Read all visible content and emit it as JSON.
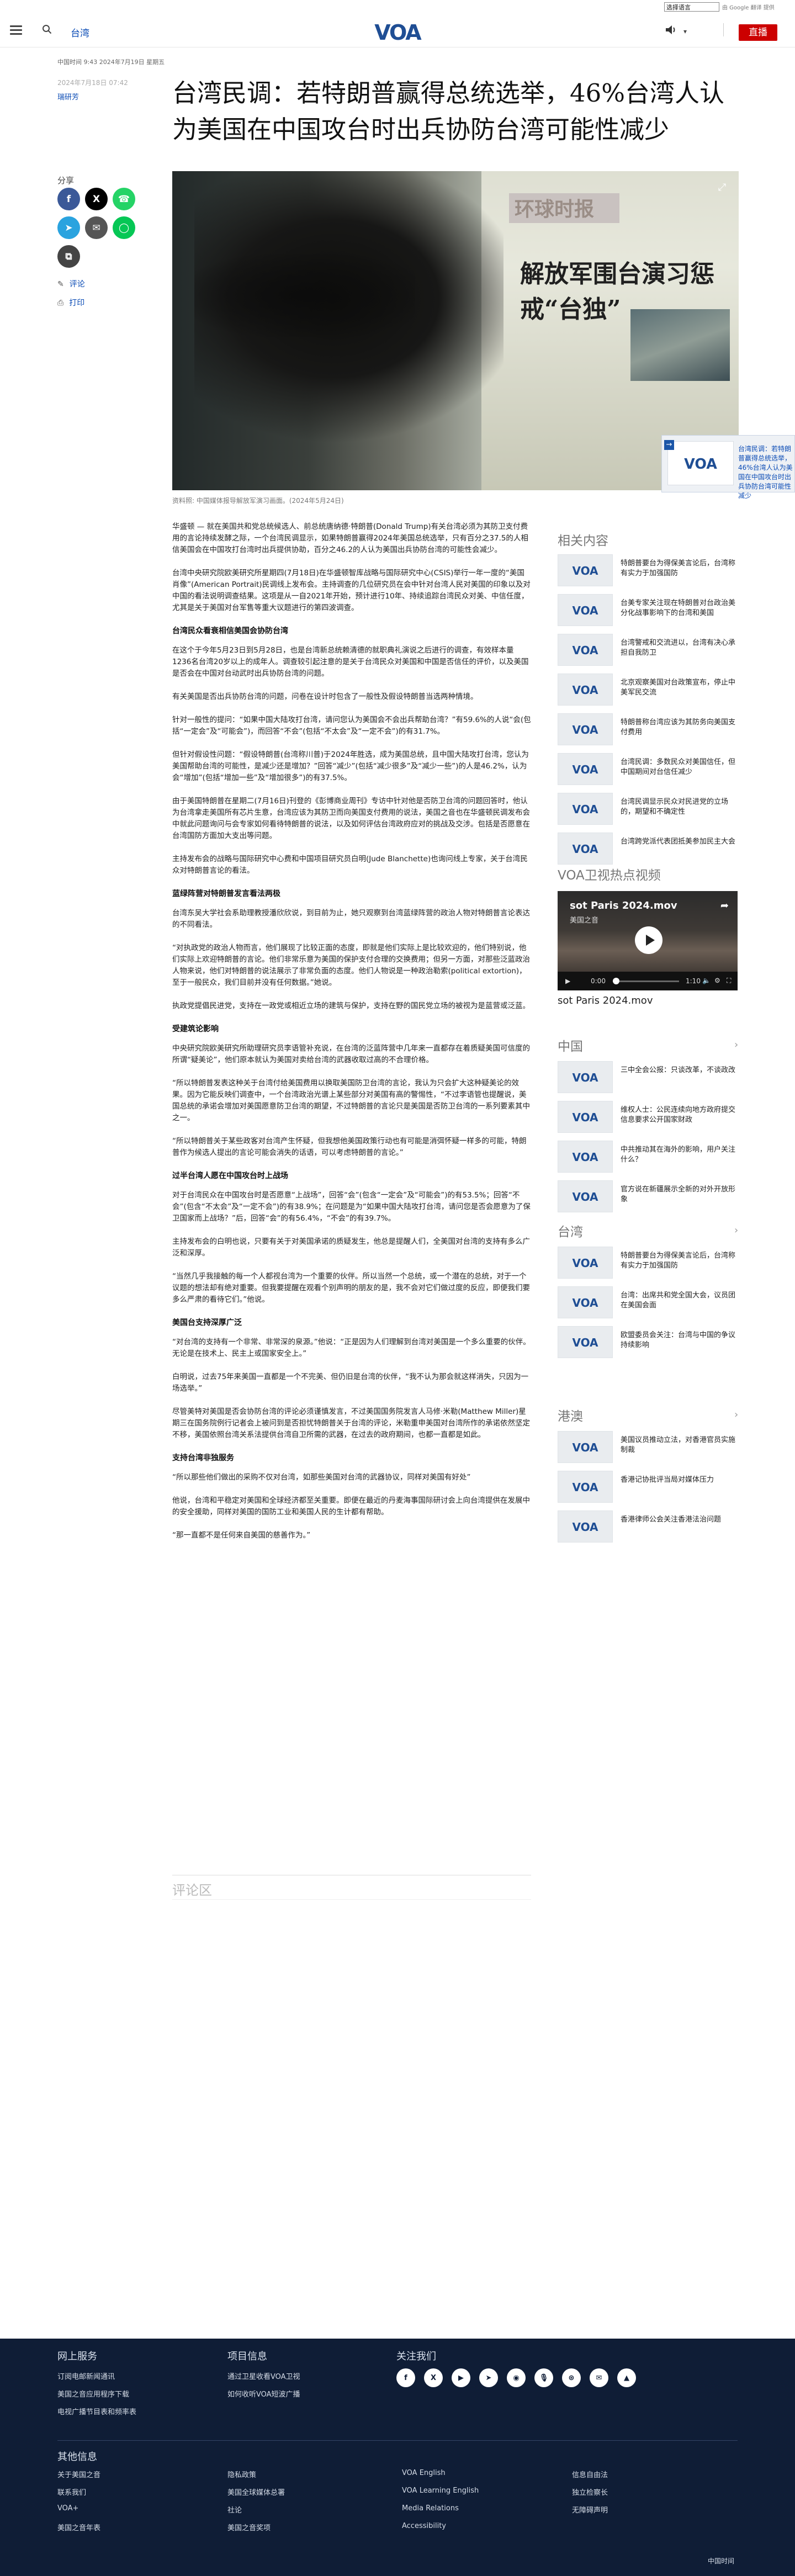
{
  "header": {
    "section": "台湾",
    "language_select": "选择语言",
    "google_translate": "由 Google 翻译 提供",
    "live_label": "直播",
    "logo_text": "VOA"
  },
  "article": {
    "dateline_top": "中国时间 9:43 2024年7月19日 星期五",
    "dateline": "2024年7月18日 07:42",
    "byline": "瑞研芳",
    "title": "台湾民调：若特朗普赢得总统选举，46%台湾人认为美国在中国攻台时出兵协防台湾可能性减少",
    "share_label": "分享",
    "comment_link": "评论",
    "print_link": "打印",
    "hero_masthead": "环球时报",
    "hero_headline": "解放军围台演习惩戒“台独”",
    "image_caption": "资料照: 中国媒体报导解放军演习画面。(2024年5月24日)",
    "paragraphs": [
      {
        "type": "p",
        "text": "华盛顿 — 就在美国共和党总统候选人、前总统唐纳德·特朗普(Donald Trump)有关台湾必须为其防卫支付费用的言论持续发酵之际，一个台湾民调显示，如果特朗普赢得2024年美国总统选举，只有百分之37.5的人相信美国会在中国攻打台湾时出兵提供协助，百分之46.2的人认为美国出兵协防台湾的可能性会减少。"
      },
      {
        "type": "p",
        "text": "台湾中央研究院欧美研究所星期四(7月18日)在华盛顿智库战略与国际研究中心(CSIS)举行一年一度的“美国肖像”(American Portrait)民调线上发布会。主持调查的几位研究员在会中针对台湾人民对美国的印象以及对中国的看法说明调查结果。这项是从一自2021年开始，预计进行10年、持续追踪台湾民众对美、中信任度，尤其是关于美国对台军售等重大议题进行的第四波调查。"
      },
      {
        "type": "h",
        "text": "台湾民众看衰相信美国会协防台湾"
      },
      {
        "type": "p",
        "text": "在这个于今年5月23日到5月28日，也是台湾新总统赖清德的就职典礼演说之后进行的调查，有效样本量1236名台湾20岁以上的成年人。调查较引起注意的是关于台湾民众对美国和中国是否信任的评价，以及美国是否会在中国对台动武时出兵协防台湾的问题。"
      },
      {
        "type": "p",
        "text": "有关美国是否出兵协防台湾的问题，问卷在设计时包含了一般性及假设特朗普当选两种情境。"
      },
      {
        "type": "p",
        "text": "针对一般性的提问：“如果中国大陆攻打台湾，请问您认为美国会不会出兵帮助台湾？”有59.6%的人说“会(包括“一定会”及“可能会”)，而回答“不会”(包括“不太会”及“一定不会”)的有31.7%。"
      },
      {
        "type": "p",
        "text": "但针对假设性问题：“假设特朗普(台湾称川普)于2024年胜选，成为美国总统，且中国大陆攻打台湾，您认为美国帮助台湾的可能性，是减少还是增加？”回答“减少”(包括“减少很多”及“减少一些”)的人是46.2%，认为会“增加”(包括“增加一些”及“增加很多”)的有37.5%。"
      },
      {
        "type": "p",
        "text": "由于美国特朗普在星期二(7月16日)刊登的《彭博商业周刊》专访中针对他是否防卫台湾的问题回答时，他认为台湾拿走美国所有芯片生意，台湾应该为其防卫而向美国支付费用的说法，美国之音也在华盛顿民调发布会中就此问题询问与会专家如何看待特朗普的说法，以及如何评估台湾政府应对的挑战及交涉。包括是否愿意在台湾国防方面加大支出等问题。"
      },
      {
        "type": "p",
        "text": "主持发布会的战略与国际研究中心费和中国项目研究员白明(Jude Blanchette)也询问线上专家，关于台湾民众对特朗普言论的看法。"
      },
      {
        "type": "h",
        "text": "蓝绿阵营对特朗普发言看法两极"
      },
      {
        "type": "p",
        "text": "台湾东吴大学社会系助理教授潘欣欣说，到目前为止，她只观察到台湾蓝绿阵营的政治人物对特朗普言论表达的不同看法。"
      },
      {
        "type": "p",
        "text": "“对执政党的政治人物而言，他们展现了比较正面的态度，即就是他们实际上是比较欢迎的，他们特别说，他们实际上欢迎特朗普的言论。他们非常乐意为美国的保护支付合理的交换费用；但另一方面，对那些泛蓝政治人物来说，他们对特朗普的说法展示了非常负面的态度。他们人物说是一种政治勒索(political extortion)，至于一般民众，我们目前并没有任何数据。”她说。"
      },
      {
        "type": "p",
        "text": "执政党提倡民进党，支持在一政党或相近立场的建筑与保护，支持在野的国民党立场的被视为是蓝营或泛蓝。"
      },
      {
        "type": "h",
        "text": "受建筑论影响"
      },
      {
        "type": "p",
        "text": "中央研究院欧美研究所助理研究员李语管补充说，在台湾的泛蓝阵营中几年来一直都存在着质疑美国可信度的所谓“疑美论”，他们原本就认为美国对卖给台湾的武器收取过高的不合理价格。"
      },
      {
        "type": "p",
        "text": "“所以特朗普发表这种关于台湾付给美国费用以换取美国防卫台湾的言论，我认为只会扩大这种疑美论的效果。因为它能反映们调查中，一个台湾政治光谱上某些部分对美国有高的警惕性，“不过李语管也提醒说，美国总统的承诺会增加对美国愿意防卫台湾的期望，不过特朗普的言论只是美国是否防卫台湾的一系列要素其中之一。"
      },
      {
        "type": "p",
        "text": "“所以特朗普关于某些政客对台湾产生怀疑，但我想他美国政策行动也有可能是消弭怀疑一样多的可能，特朗普作为候选人提出的言论可能会消失的话语，可以考虑特朗普的言论。”"
      },
      {
        "type": "h",
        "text": "过半台湾人愿在中国攻台时上战场"
      },
      {
        "type": "p",
        "text": "对于台湾民众在中国攻台时是否愿意“上战场”，回答“会”(包含“一定会”及“可能会”)的有53.5%；回答“不会”(包含“不太会”及“一定不会”)的有38.9%；在问题是为“如果中国大陆攻打台湾，请问您是否会愿意为了保卫国家而上战场？”后，回答“会”的有56.4%，“不会”的有39.7%。"
      },
      {
        "type": "p",
        "text": "主持发布会的白明也说，只要有关于对美国承诺的质疑发生，他总是提醒人们，全美国对台湾的支持有多么广泛和深厚。"
      },
      {
        "type": "p",
        "text": "“当然几乎我接触的每一个人都视台湾为一个重要的伙伴。所以当然一个总统，或一个潜在的总统，对于一个议题的想法却有绝对重要。但我要提醒在观看个别声明的朋友的是，我不会对它们做过度的反应，即便我们要多么严肃的看待它们。”他说。"
      },
      {
        "type": "h",
        "text": "美国台支持深厚广泛"
      },
      {
        "type": "p",
        "text": "“对台湾的支持有一个非常、非常深的泉源。”他说：“正是因为人们理解到台湾对美国是一个多么重要的伙伴。无论是在技术上、民主上或国家安全上。”"
      },
      {
        "type": "p",
        "text": "白明说，过去75年来美国一直都是一个不完美、但仍旧是台湾的伙伴，“我不认为那会就这样消失，只因为一场选举。”"
      },
      {
        "type": "p",
        "text": "尽管美特对美国是否会协防台湾的评论必须谨慎发言，不过美国国务院发言人马修·米勒(Matthew Miller)星期三在国务院例行记者会上被问到是否担忧特朗普关于台湾的评论，米勒重申美国对台湾所作的承诺依然坚定不移，美国依照台湾关系法提供台湾自卫所需的武器，在过去的政府期间，也都一直都是如此。"
      },
      {
        "type": "h",
        "text": "支持台湾非独服务"
      },
      {
        "type": "p",
        "text": "“所以那些他们做出的采购不仅对台湾，如那些美国对台湾的武器协议，同样对美国有好处”"
      },
      {
        "type": "p",
        "text": "他说，台湾和平稳定对美国和全球经济都至关重要。即便在最近的丹麦海事国际研讨会上向台湾提供在发展中的安全援助，同样对美国的国防工业和美国人民的生计都有帮助。"
      },
      {
        "type": "p",
        "text": "“那一直都不是任何来自美国的慈善作为。”"
      }
    ],
    "comments_heading": "评论区"
  },
  "floating_card": {
    "text": "台湾民调：若特朗普赢得总统选举，46%台湾人认为美国在中国攻台时出兵协防台湾可能性减少"
  },
  "sidebar": {
    "related": {
      "heading": "相关内容",
      "items": [
        "特朗普要台为得保美言论后，台湾称有实力于加强国防",
        "台美专家关注现在特朗普对台政治美分化战事影响下的台湾和美国",
        "台湾警戒和交流进以，台湾有决心承担自我防卫",
        "北京观察美国对台政策宣布，停止中美军民交流",
        "特朗普称台湾应该为其防务向美国支付费用",
        "台湾民调：多数民众对美国信任，但中国期间对台信任减少",
        "台湾民调显示民众对民进党的立场的，期望和不确定性",
        "台湾跨党派代表团抵美参加民主大会"
      ]
    },
    "video": {
      "heading": "VOA卫视热点视频",
      "title": "sot Paris 2024.mov",
      "subtitle": "美国之音",
      "time_current": "0:00",
      "time_total": "1:10",
      "progress": 0,
      "caption": "sot Paris 2024.mov"
    },
    "china": {
      "heading": "中国",
      "items": [
        "三中全会公报：只谈改革，不谈政改",
        "维权人士：公民连续向地方政府提交信息要求公开国家财政",
        "中共推动其在海外的影响，用户关注什么？",
        "官方说在新疆展示全新的对外开放形象"
      ]
    },
    "taiwan": {
      "heading": "台湾",
      "items": [
        "特朗普要台为得保美言论后，台湾称有实力于加强国防",
        "台湾：出席共和党全国大会，议员团在美国会面",
        "欧盟委员会关注：台湾与中国的争议持续影响"
      ]
    },
    "hongkong": {
      "heading": "港澳",
      "items": [
        "美国议员推动立法，对香港官员实施制裁",
        "香港记协批评当局对媒体压力",
        "香港律师公会关注香港法治问题"
      ]
    }
  },
  "footer": {
    "online_service": {
      "heading": "网上服务",
      "links": [
        "订阅电邮新闻通讯",
        "美国之音应用程序下载",
        "电视广播节目表和频率表"
      ]
    },
    "projects": {
      "heading": "项目信息",
      "links": [
        "通过卫星收看VOA卫视",
        "如何收听VOA短波广播"
      ]
    },
    "follow": {
      "heading": "关注我们",
      "icons": [
        "facebook-icon",
        "x-icon",
        "youtube-icon",
        "telegram-icon",
        "instagram-icon",
        "podcast-icon",
        "rss-icon",
        "mail-icon",
        "android-icon"
      ]
    },
    "other_info": {
      "heading": "其他信息",
      "links": [
        "关于美国之音",
        "联系我们",
        "VOA+",
        "美国之音年表",
        "隐私政策",
        "美国全球媒体总署",
        "社论",
        "美国之音奖项",
        "VOA English",
        "VOA Learning English",
        "Media Relations",
        "Accessibility",
        "信息自由法",
        "独立检察长",
        "无障碍声明"
      ]
    },
    "copyright": "中国时间"
  }
}
